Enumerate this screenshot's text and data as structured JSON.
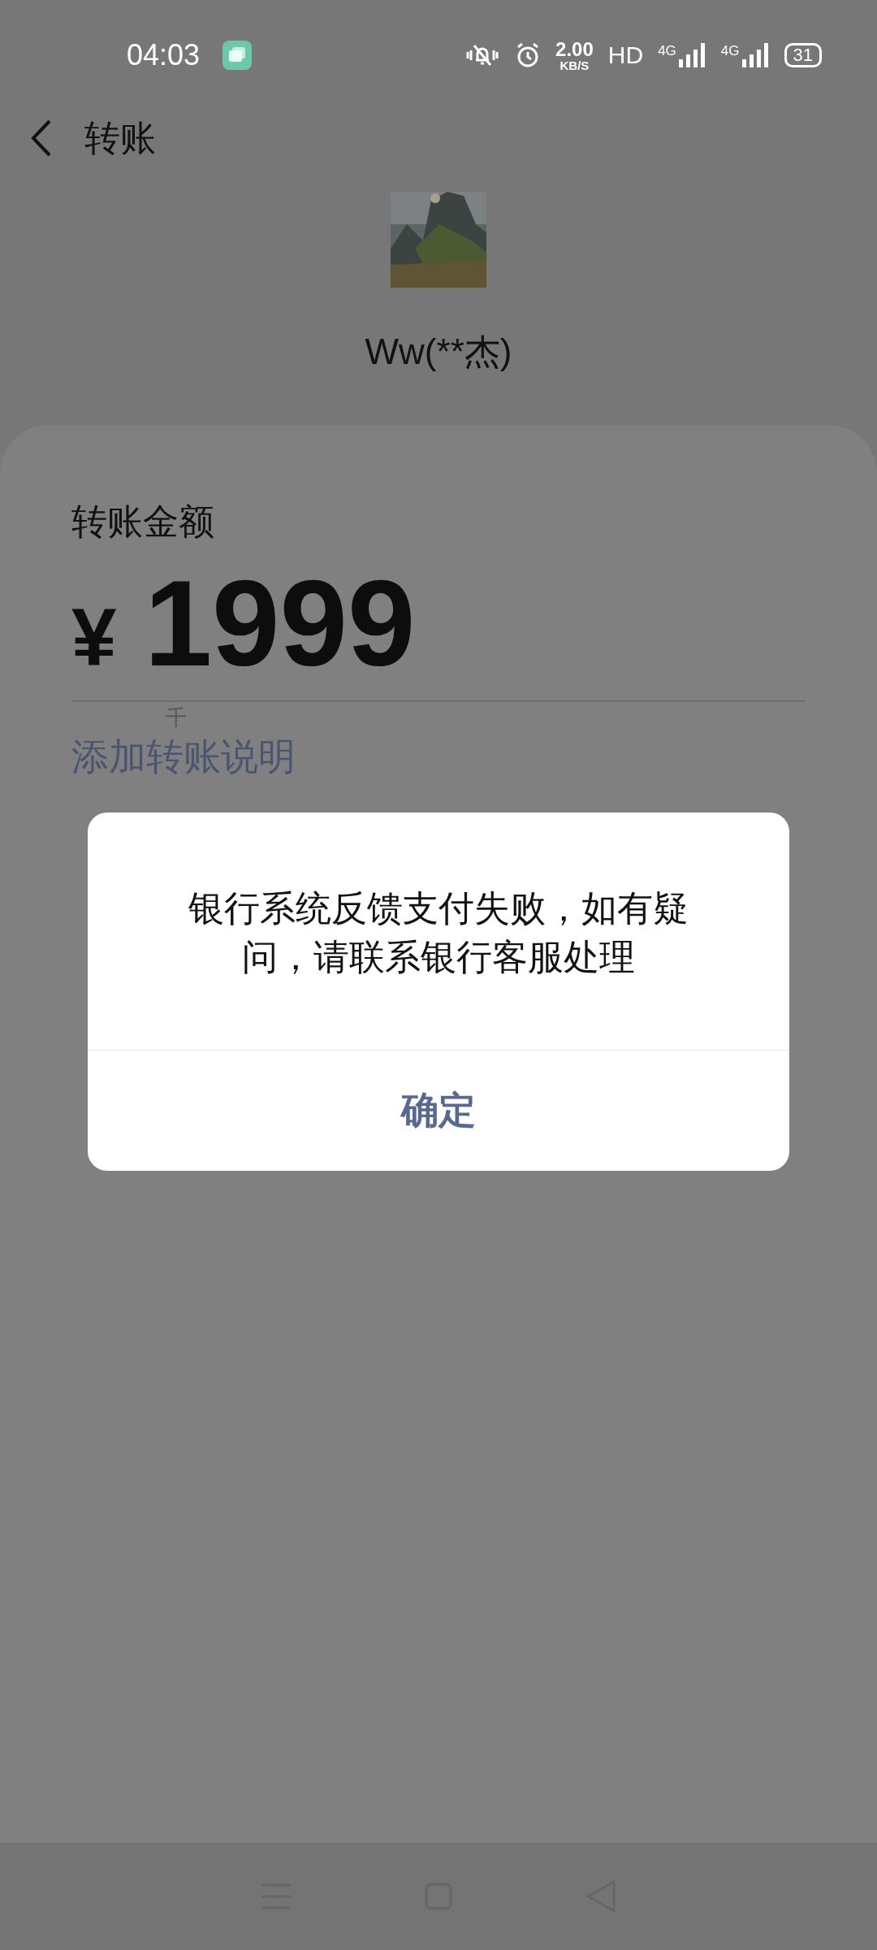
{
  "status_bar": {
    "time": "04:03",
    "speed_value": "2.00",
    "speed_unit": "KB/S",
    "hd": "HD",
    "networks": [
      "4G",
      "4G"
    ],
    "battery": "31"
  },
  "header": {
    "title": "转账"
  },
  "payee": {
    "name": "Ww(**杰)"
  },
  "amount_card": {
    "label": "转账金额",
    "currency": "¥",
    "amount": "1999",
    "digit_hint": "千",
    "note_link": "添加转账说明"
  },
  "dialog": {
    "message": "银行系统反馈支付失败，如有疑问，请联系银行客服处理",
    "button": "确定"
  }
}
